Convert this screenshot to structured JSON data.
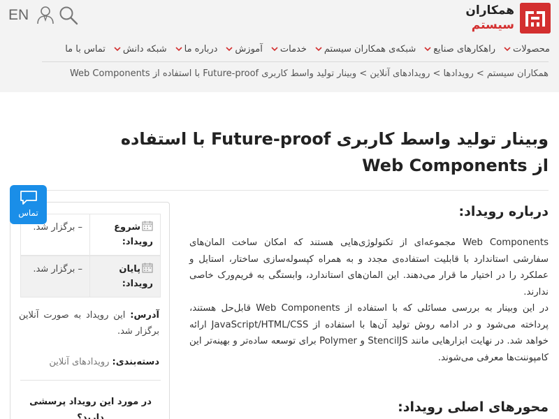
{
  "header": {
    "lang": "EN",
    "user_icon": "user-icon",
    "search_icon": "search-icon",
    "logo": {
      "line1": "همکاران",
      "line2": "سیستم",
      "brand_color": "#d32f2f"
    }
  },
  "nav": [
    "محصولات",
    "راهکارهای صنایع",
    "شبکه‌ی همکاران سیستم",
    "خدمات",
    "آموزش",
    "درباره ما",
    "شبکه دانش",
    "تماس با ما"
  ],
  "breadcrumb": "همکاران سیستم > رویدادها > رویدادهای آنلاین > وبینار تولید واسط کاربری Future-proof با استفاده از Web Components",
  "title": "وبینار تولید واسط کاربری Future-proof با استفاده از Web Components",
  "about_heading": "درباره رویداد:",
  "description": [
    "Web Components مجموعه‌ای از تکنولوژی‌هایی هستند که امکان ساخت المان‌های سفارشی استاندارد با قابلیت استفاده‌ی مجدد و به همراه کپسوله‌سازی ساختار، استایل و عملکرد را در اختیار ما قرار می‌دهند. این المان‌های استاندارد، وابستگی به فریم‌ورک خاصی ندارند.",
    "در این وبینار به بررسی مسائلی که با استفاده از Web Components قابل‌حل هستند، پرداخته می‌شود و در ادامه روش تولید آن‌ها با استفاده از JavaScript/HTML/CSS ارائه خواهد شد. در نهایت ابزارهایی مانند StencilJS و Polymer برای توسعه ساده‌تر و بهینه‌تر این کامپوننت‌ها معرفی می‌شوند."
  ],
  "topics_heading": "محورهای اصلی رویداد:",
  "sidebar": {
    "start_label": "شروع رویداد:",
    "start_value": "– برگزار شد.",
    "end_label": "پایان رویداد:",
    "end_value": "– برگزار شد.",
    "address_label": "آدرس:",
    "address_value": "این رویداد به صورت آنلاین برگزار شد.",
    "category_label": "دسته‌بندی:",
    "category_value": "رویدادهای آنلاین",
    "question": "در مورد این رویداد پرسشی دارید؟"
  },
  "contact": {
    "label": "تماس",
    "icon": "chat-icon",
    "color": "#1a8ee8"
  }
}
